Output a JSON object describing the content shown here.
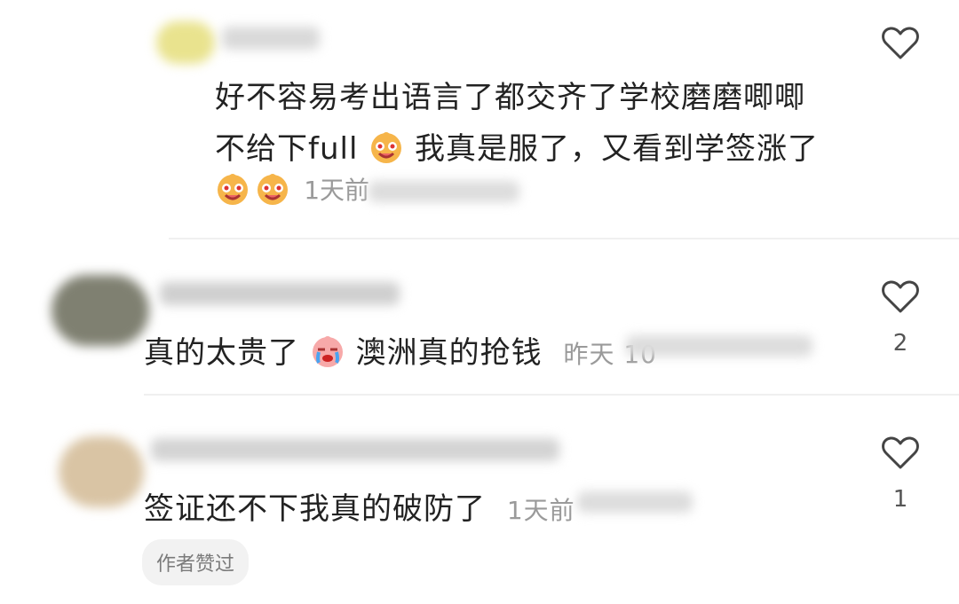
{
  "comments": [
    {
      "line1": "好不容易考出语言了都交齐了学校磨磨唧唧",
      "line2_prefix": "不给下full",
      "line2_suffix": " 我真是服了，又看到学签涨了",
      "time": "1天前",
      "likes": ""
    },
    {
      "text_prefix": "真的太贵了",
      "text_suffix": "澳洲真的抢钱",
      "time": "昨天 10",
      "likes": "2"
    },
    {
      "text": "签证还不下我真的破防了",
      "time": "1天前",
      "likes": "1",
      "author_badge": "作者赞过"
    }
  ],
  "icons": [
    "heart-outline-icon",
    "smiling-emoji-icon",
    "crying-emoji-icon"
  ]
}
